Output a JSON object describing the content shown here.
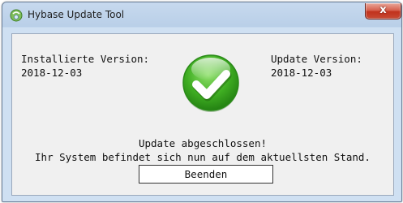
{
  "window": {
    "title": "Hybase Update Tool",
    "close_label": "x"
  },
  "installed": {
    "label": "Installierte Version:",
    "value": "2018-12-03"
  },
  "update": {
    "label": "Update Version:",
    "value": "2018-12-03"
  },
  "status": {
    "line1": "Update abgeschlossen!",
    "line2": "Ihr System befindet sich nun auf dem aktuellsten Stand."
  },
  "actions": {
    "finish_label": "Beenden"
  },
  "icons": {
    "app": "hybase-app-icon",
    "status": "checkmark-success-icon"
  },
  "colors": {
    "success_green": "#3aa41c",
    "close_red": "#c7402b"
  }
}
